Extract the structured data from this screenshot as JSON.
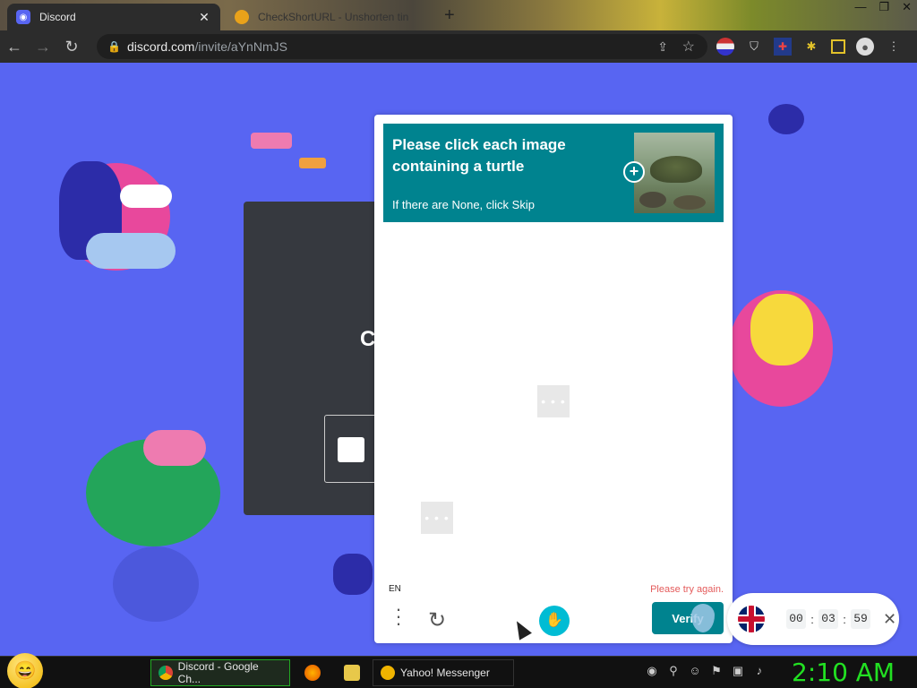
{
  "browser": {
    "tabs": [
      {
        "title": "Discord",
        "close": "✕"
      },
      {
        "title": "CheckShortURL - Unshorten tin",
        "close": ""
      }
    ],
    "new_tab": "+",
    "window_controls": [
      "—",
      "❐",
      "✕"
    ],
    "nav": {
      "back": "←",
      "forward": "→",
      "reload": "↻"
    },
    "url": {
      "domain": "discord.com",
      "path": "/invite/aYnNmJS"
    }
  },
  "page": {
    "background_color": "#5865f2",
    "modal_letter": "C"
  },
  "captcha": {
    "prompt_title": "Please click each image containing a turtle",
    "prompt_subtitle": "If there are None, click Skip",
    "example_image": "turtle",
    "zoom_icon": "+",
    "loading_dots": "• • •",
    "language": "EN",
    "error": "Please try again.",
    "verify_label": "Verify",
    "accent_color": "#00838f"
  },
  "timer": {
    "hh": "00",
    "mm": "03",
    "ss": "59",
    "sep": ":",
    "close": "✕"
  },
  "taskbar": {
    "start_icon": "😄",
    "buttons": [
      {
        "label": "Discord - Google Ch..."
      },
      {
        "label": "Yahoo! Messenger"
      }
    ],
    "clock": "2:10 AM",
    "clock_color": "#22e022"
  }
}
